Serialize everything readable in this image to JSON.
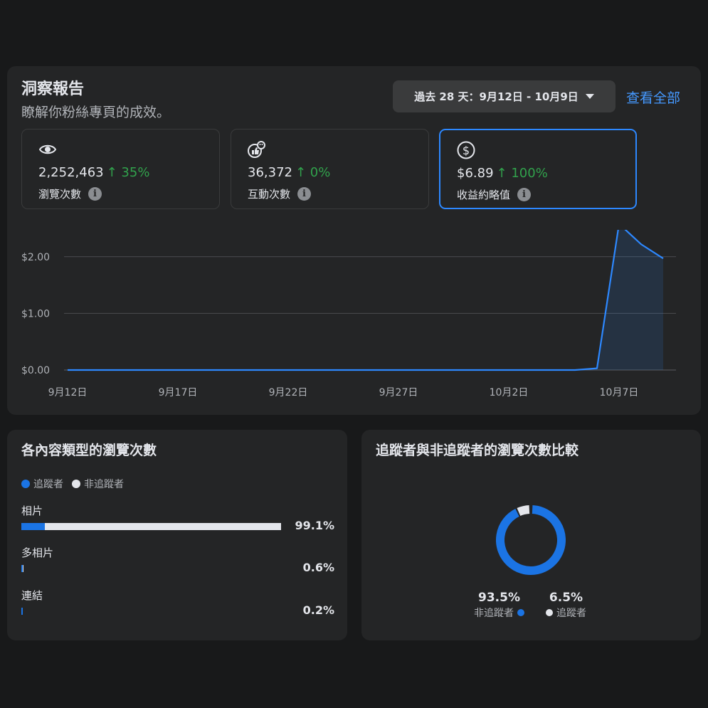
{
  "insights": {
    "title": "洞察報告",
    "subtitle": "瞭解你粉絲專頁的成效。",
    "date_range": "過去 28 天：9月12日 - 10月9日",
    "see_all": "查看全部",
    "metrics": [
      {
        "icon": "eye-icon",
        "value": "2,252,463",
        "change": "↑ 35%",
        "label": "瀏覽次數"
      },
      {
        "icon": "reaction-icon",
        "value": "36,372",
        "change": "↑ 0%",
        "label": "互動次數"
      },
      {
        "icon": "dollar-icon",
        "value": "$6.89",
        "change": "↑ 100%",
        "label": "收益約略值",
        "selected": true
      }
    ]
  },
  "chart_data": {
    "type": "area",
    "x_tick_labels": [
      "9月12日",
      "9月17日",
      "9月22日",
      "9月27日",
      "10月2日",
      "10月7日"
    ],
    "y_tick_labels": [
      "$0.00",
      "$1.00",
      "$2.00"
    ],
    "ylim": [
      0,
      2.6
    ],
    "x": [
      "9月12日",
      "9月13日",
      "9月14日",
      "9月15日",
      "9月16日",
      "9月17日",
      "9月18日",
      "9月19日",
      "9月20日",
      "9月21日",
      "9月22日",
      "9月23日",
      "9月24日",
      "9月25日",
      "9月26日",
      "9月27日",
      "9月28日",
      "9月29日",
      "9月30日",
      "10月1日",
      "10月2日",
      "10月3日",
      "10月4日",
      "10月5日",
      "10月6日",
      "10月7日",
      "10月8日",
      "10月9日"
    ],
    "series": [
      {
        "values": [
          0,
          0,
          0,
          0,
          0,
          0,
          0,
          0,
          0,
          0,
          0,
          0,
          0,
          0,
          0,
          0,
          0,
          0,
          0,
          0,
          0,
          0,
          0,
          0,
          0.03,
          2.58,
          2.22,
          1.97
        ]
      }
    ],
    "grid": true,
    "color": "#2d88ff"
  },
  "content_types": {
    "title": "各內容類型的瀏覽次數",
    "legend": [
      {
        "label": "追蹤者",
        "color": "#1b74e4"
      },
      {
        "label": "非追蹤者",
        "color": "#e4e6eb"
      }
    ],
    "rows": [
      {
        "label": "相片",
        "pct": "99.1%",
        "share": 0.991,
        "follower_fraction": 0.09
      },
      {
        "label": "多相片",
        "pct": "0.6%",
        "share": 0.006,
        "follower_fraction": 0.5
      },
      {
        "label": "連結",
        "pct": "0.2%",
        "share": 0.002,
        "follower_fraction": 1.0
      }
    ]
  },
  "follower_compare": {
    "title": "追蹤者與非追蹤者的瀏覽次數比較",
    "non_follower": {
      "pct": "93.5%",
      "label": "非追蹤者",
      "fraction": 0.935,
      "color": "#1b74e4"
    },
    "follower": {
      "pct": "6.5%",
      "label": "追蹤者",
      "fraction": 0.065,
      "color": "#e4e6eb"
    }
  }
}
